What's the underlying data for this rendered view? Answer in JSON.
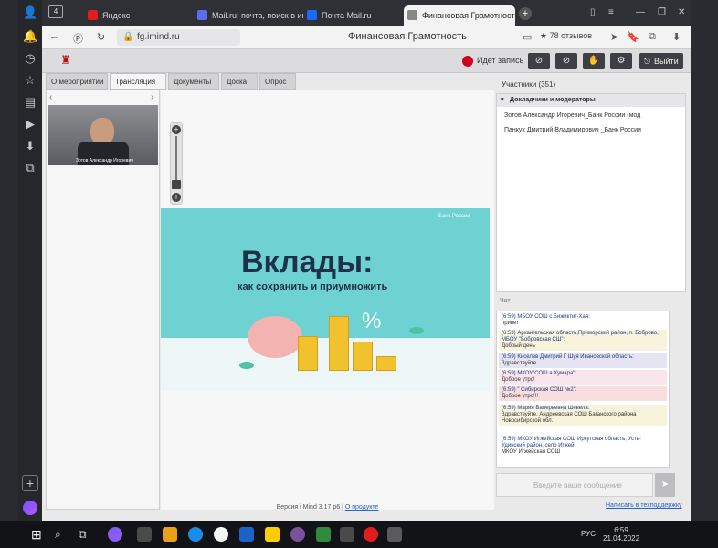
{
  "browser": {
    "tabs": [
      {
        "label": "Яндекс",
        "color": "#e21c1c"
      },
      {
        "label": "Mail.ru: почта, поиск в инт",
        "color": "#5b6cf0"
      },
      {
        "label": "Почта Mail.ru",
        "color": "#1769ff"
      },
      {
        "label": "Финансовая Грамотност",
        "color": "#888888"
      }
    ],
    "tab_count": "4",
    "url": "fg.imind.ru",
    "page_title": "Финансовая Грамотность",
    "reviews": "78 отзывов"
  },
  "toolbar": {
    "record_label": "Идет запись",
    "exit_label": "Выйти",
    "icons": [
      "camera-off-icon",
      "mic-off-icon",
      "hand-icon",
      "gear-icon"
    ]
  },
  "main_tabs": [
    "О мероприятии",
    "Трансляция",
    "Документы",
    "Доска",
    "Опрос"
  ],
  "active_tab": "Трансляция",
  "slide": {
    "title": "Вклады:",
    "subtitle": "как сохранить и приумножить",
    "bank_logo": "Банк России"
  },
  "camera": {
    "caption": "Зотов Александр Игоревич"
  },
  "participants": {
    "header": "Участники (351)",
    "group": "Докладчики и модераторы",
    "people": [
      "Зотов Александр Игоревич_Банк России (мод",
      "Панкух Дмитрий Владимирович _Банк России"
    ]
  },
  "chat": {
    "header": "Чат",
    "messages": [
      {
        "who": "(6:59) МБОУ СОШ с.Бижиктиг-Хая:",
        "text": "привет",
        "bg": "#ffffff"
      },
      {
        "who": "(6:59) Архангельская область,Приморский район, п. Боброво, МБОУ \"Бобровская СШ\":",
        "text": "Добрый день",
        "bg": "#f8f3dc"
      },
      {
        "who": "(6:59) Киселев Дмитрий Г Шуя Ивановской область:",
        "text": "Здравствуйте",
        "bg": "#e4e4f2"
      },
      {
        "who": "(6:59) МКОУ\"СОШ а.Хумара\":",
        "text": "Доброе утро!",
        "bg": "#f9e6ec"
      },
      {
        "who": "(6:59) \" Сибирская СОШ №2\":",
        "text": "Доброе утро!!!",
        "bg": "#f8dede"
      },
      {
        "who": "(6:59) Мария Валерьевна Шевела:",
        "text": "Здравствуйте. Андреевская СОШ Баганского района Новосибирской обл.",
        "bg": "#f8f3dc"
      },
      {
        "who": "(6:59) МКОУ Игжейская СОШ Иркутская область, Усть-Удинский район, село Игжей:",
        "text": "МКОУ Игжейская СОШ",
        "bg": "#ffffff"
      }
    ],
    "input_placeholder": "Введите ваше сообщение",
    "report_link": "Написать в техподдержку"
  },
  "footer": {
    "version": "Версия i Mind 3.17 p6",
    "about_link": "О продукте"
  },
  "taskbar": {
    "lang": "РУС",
    "time": "6:59",
    "date": "21.04.2022"
  }
}
